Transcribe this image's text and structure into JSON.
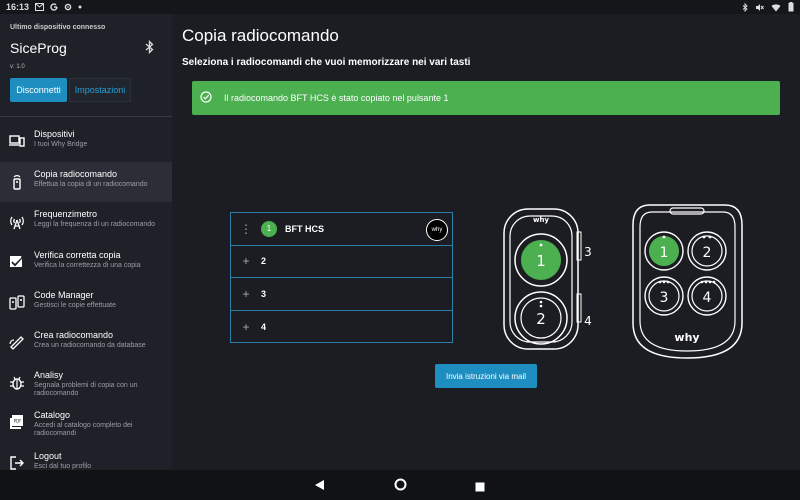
{
  "status_bar": {
    "time": "16:13",
    "left_icons": [
      "gmail-icon",
      "google-icon",
      "settings-gear-icon",
      "dot-icon"
    ],
    "right_icons": [
      "bluetooth-icon",
      "mute-icon",
      "wifi-icon",
      "battery-icon"
    ]
  },
  "sidebar": {
    "last_device_label": "Ultimo dispositivo connesso",
    "app_name": "SiceProg",
    "version": "v: 1.0",
    "disconnect_label": "Disconnetti",
    "settings_label": "Impostazioni",
    "items": [
      {
        "title": "Dispositivi",
        "subtitle": "I tuoi Why Bridge",
        "icon": "devices-icon"
      },
      {
        "title": "Copia radiocomando",
        "subtitle": "Effettua la copia di un radiocomando",
        "icon": "remote-icon"
      },
      {
        "title": "Frequenzimetro",
        "subtitle": "Leggi la frequenza di un radiocomando",
        "icon": "antenna-icon"
      },
      {
        "title": "Verifica corretta copia",
        "subtitle": "Verifica la correttezza di una copia",
        "icon": "verify-icon"
      },
      {
        "title": "Code Manager",
        "subtitle": "Gestisci le copie effettuate",
        "icon": "code-manager-icon"
      },
      {
        "title": "Crea radiocomando",
        "subtitle": "Crea un radiocomando da database",
        "icon": "create-remote-icon"
      },
      {
        "title": "Analisy",
        "subtitle": "Segnala problemi di copia con un radiocomando",
        "icon": "bug-icon"
      },
      {
        "title": "Catalogo",
        "subtitle": "Accedi al catalogo completo dei radiocomandi",
        "icon": "pdf-icon"
      },
      {
        "title": "Logout",
        "subtitle": "Esci dal tuo profilo",
        "icon": "logout-icon"
      }
    ]
  },
  "main": {
    "title": "Copia radiocomando",
    "subtitle": "Seleziona i radiocomandi che vuoi memorizzare nei vari tasti",
    "alert_text": "Il radiocomando BFT HCS è stato copiato nel pulsante 1",
    "rows": [
      {
        "number": "1",
        "label": "BFT HCS",
        "logo": "why"
      },
      {
        "number": "2"
      },
      {
        "number": "3"
      },
      {
        "number": "4"
      }
    ],
    "remote_small": {
      "buttons": [
        "1",
        "2"
      ],
      "side_labels": [
        "3",
        "4"
      ],
      "brand": "why"
    },
    "remote_large": {
      "buttons": [
        "1",
        "2",
        "3",
        "4"
      ],
      "brand": "why"
    },
    "send_button": "Invia istruzioni via mail",
    "accent_color": "#1e8dbf",
    "success_color": "#4caf50"
  }
}
